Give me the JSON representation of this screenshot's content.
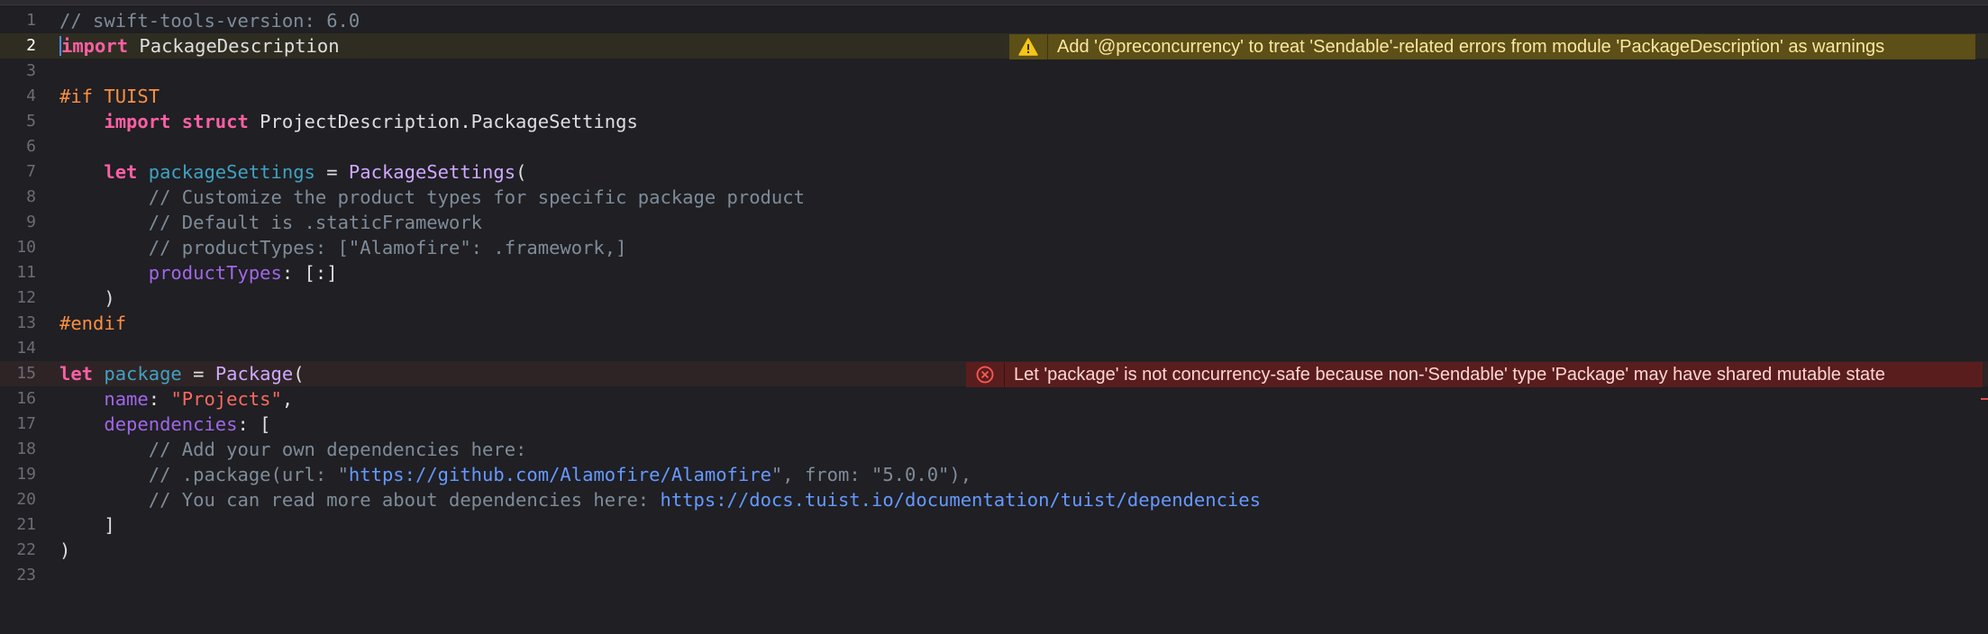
{
  "editor": {
    "active_line": "2",
    "lines": [
      {
        "num": "1",
        "t": [
          [
            "cm",
            "// swift-tools-version: 6.0"
          ]
        ]
      },
      {
        "num": "2",
        "t": [
          [
            "kw",
            "import"
          ],
          [
            "plain",
            " PackageDescription"
          ]
        ]
      },
      {
        "num": "3",
        "t": []
      },
      {
        "num": "4",
        "t": [
          [
            "pp",
            "#if TUIST"
          ]
        ]
      },
      {
        "num": "5",
        "t": [
          [
            "plain",
            "    "
          ],
          [
            "kw",
            "import struct"
          ],
          [
            "plain",
            " ProjectDescription.PackageSettings"
          ]
        ]
      },
      {
        "num": "6",
        "t": []
      },
      {
        "num": "7",
        "t": [
          [
            "plain",
            "    "
          ],
          [
            "kw",
            "let"
          ],
          [
            "plain",
            " "
          ],
          [
            "decl",
            "packageSettings"
          ],
          [
            "plain",
            " = "
          ],
          [
            "type",
            "PackageSettings"
          ],
          [
            "plain",
            "("
          ]
        ]
      },
      {
        "num": "8",
        "t": [
          [
            "plain",
            "        "
          ],
          [
            "cm",
            "// Customize the product types for specific package product"
          ]
        ]
      },
      {
        "num": "9",
        "t": [
          [
            "plain",
            "        "
          ],
          [
            "cm",
            "// Default is .staticFramework"
          ]
        ]
      },
      {
        "num": "10",
        "t": [
          [
            "plain",
            "        "
          ],
          [
            "cm",
            "// productTypes: [\"Alamofire\": .framework,]"
          ]
        ]
      },
      {
        "num": "11",
        "t": [
          [
            "plain",
            "        "
          ],
          [
            "prop",
            "productTypes"
          ],
          [
            "plain",
            ": [:]"
          ]
        ]
      },
      {
        "num": "12",
        "t": [
          [
            "plain",
            "    )"
          ]
        ]
      },
      {
        "num": "13",
        "t": [
          [
            "pp",
            "#endif"
          ]
        ]
      },
      {
        "num": "14",
        "t": []
      },
      {
        "num": "15",
        "t": [
          [
            "kw",
            "let"
          ],
          [
            "plain",
            " "
          ],
          [
            "decl",
            "package"
          ],
          [
            "plain",
            " = "
          ],
          [
            "type",
            "Package"
          ],
          [
            "plain",
            "("
          ]
        ]
      },
      {
        "num": "16",
        "t": [
          [
            "plain",
            "    "
          ],
          [
            "prop",
            "name"
          ],
          [
            "plain",
            ": "
          ],
          [
            "str",
            "\"Projects\""
          ],
          [
            "plain",
            ","
          ]
        ]
      },
      {
        "num": "17",
        "t": [
          [
            "plain",
            "    "
          ],
          [
            "prop",
            "dependencies"
          ],
          [
            "plain",
            ": ["
          ]
        ]
      },
      {
        "num": "18",
        "t": [
          [
            "plain",
            "        "
          ],
          [
            "cm",
            "// Add your own dependencies here:"
          ]
        ]
      },
      {
        "num": "19",
        "t": [
          [
            "plain",
            "        "
          ],
          [
            "cm",
            "// .package(url: \""
          ],
          [
            "url",
            "https://github.com/Alamofire/Alamofire"
          ],
          [
            "cm",
            "\", from: \"5.0.0\"),"
          ]
        ]
      },
      {
        "num": "20",
        "t": [
          [
            "plain",
            "        "
          ],
          [
            "cm",
            "// You can read more about dependencies here: "
          ],
          [
            "url",
            "https://docs.tuist.io/documentation/tuist/dependencies"
          ]
        ]
      },
      {
        "num": "21",
        "t": [
          [
            "plain",
            "    ]"
          ]
        ]
      },
      {
        "num": "22",
        "t": [
          [
            "plain",
            ")"
          ]
        ]
      },
      {
        "num": "23",
        "t": []
      }
    ]
  },
  "issues": {
    "warning": {
      "icon": "warning-triangle-icon",
      "message": "Add '@preconcurrency' to treat 'Sendable'-related errors from module 'PackageDescription' as warnings",
      "color": "#5c4f17"
    },
    "error": {
      "icon": "error-circle-x-icon",
      "message": "Let 'package' is not concurrency-safe because non-'Sendable' type 'Package' may have shared mutable state",
      "color": "#5a1d1e"
    }
  }
}
